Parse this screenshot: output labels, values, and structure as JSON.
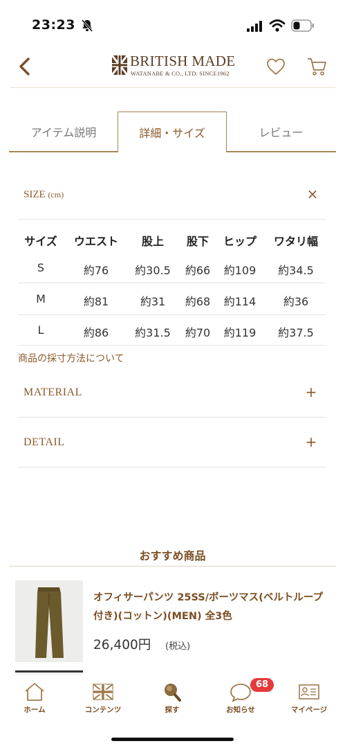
{
  "status_bar": {
    "time": "23:23"
  },
  "header": {
    "brand": "BRITISH MADE",
    "brand_sub": "WATANABE & CO., LTD. SINCE1962"
  },
  "tabs": [
    {
      "label": "アイテム説明",
      "active": false
    },
    {
      "label": "詳細・サイズ",
      "active": true
    },
    {
      "label": "レビュー",
      "active": false
    }
  ],
  "size": {
    "title": "SIZE",
    "unit": "(cm)",
    "close_symbol": "×",
    "headers": [
      "サイズ",
      "ウエスト",
      "股上",
      "股下",
      "ヒップ",
      "ワタリ幅"
    ],
    "rows": [
      [
        "S",
        "約76",
        "約30.5",
        "約66",
        "約109",
        "約34.5"
      ],
      [
        "M",
        "約81",
        "約31",
        "約68",
        "約114",
        "約36"
      ],
      [
        "L",
        "約86",
        "約31.5",
        "約70",
        "約119",
        "約37.5"
      ]
    ],
    "measure_link": "商品の採寸方法について"
  },
  "accordions": [
    {
      "label": "MATERIAL",
      "symbol": "+"
    },
    {
      "label": "DETAIL",
      "symbol": "+"
    }
  ],
  "recommend": {
    "title": "おすすめ商品",
    "product": {
      "name": "オフィサーパンツ 25SS/ボーツマス(ベルトループ付き)(コットン)(MEN) 全3色",
      "price": "26,400円",
      "tax": "(税込)"
    }
  },
  "bottom_nav": {
    "items": [
      {
        "label": "ホーム",
        "icon": "home-icon"
      },
      {
        "label": "コンテンツ",
        "icon": "union-jack-icon"
      },
      {
        "label": "探す",
        "icon": "search-icon"
      },
      {
        "label": "お知らせ",
        "icon": "chat-bubble-icon"
      },
      {
        "label": "マイページ",
        "icon": "id-card-icon"
      }
    ],
    "badge_count": "68"
  },
  "colors": {
    "brand_brown": "#7a4e22",
    "accent_tan": "#a88456",
    "badge_red": "#e5393a"
  }
}
